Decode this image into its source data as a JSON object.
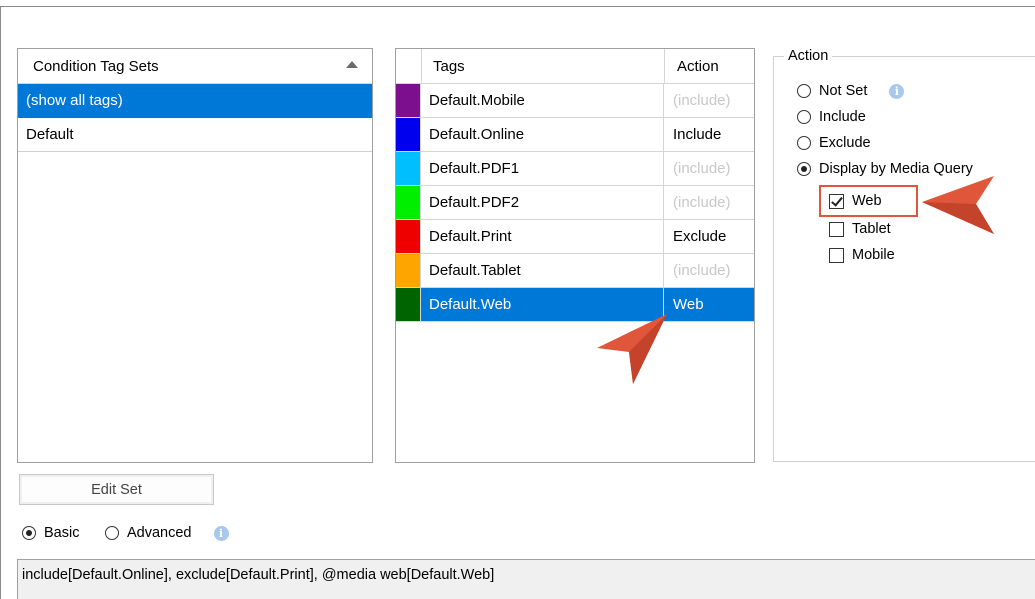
{
  "condition_tag_sets": {
    "header": "Condition Tag Sets",
    "items": [
      {
        "label": "(show all tags)",
        "selected": true
      },
      {
        "label": "Default",
        "selected": false
      }
    ]
  },
  "tags_grid": {
    "headers": {
      "tags": "Tags",
      "action": "Action"
    },
    "rows": [
      {
        "color": "#7b0f8e",
        "name": "Default.Mobile",
        "action": "(include)",
        "muted": true
      },
      {
        "color": "#0000ee",
        "name": "Default.Online",
        "action": "Include",
        "muted": false
      },
      {
        "color": "#00bfff",
        "name": "Default.PDF1",
        "action": "(include)",
        "muted": true
      },
      {
        "color": "#00ee00",
        "name": "Default.PDF2",
        "action": "(include)",
        "muted": true
      },
      {
        "color": "#ee0000",
        "name": "Default.Print",
        "action": "Exclude",
        "muted": false
      },
      {
        "color": "#ffa500",
        "name": "Default.Tablet",
        "action": "(include)",
        "muted": true
      },
      {
        "color": "#006400",
        "name": "Default.Web",
        "action": "Web",
        "muted": false,
        "selected": true
      }
    ]
  },
  "action_panel": {
    "title": "Action",
    "options": {
      "not_set": "Not Set",
      "include": "Include",
      "exclude": "Exclude",
      "display_by_media_query": "Display by Media Query"
    },
    "selected_option": "display_by_media_query",
    "media": {
      "web": "Web",
      "tablet": "Tablet",
      "mobile": "Mobile"
    },
    "checked_media": [
      "web"
    ]
  },
  "bottom": {
    "edit_set": "Edit Set",
    "mode_basic": "Basic",
    "mode_advanced": "Advanced",
    "selected_mode": "basic",
    "expression": "include[Default.Online], exclude[Default.Print], @media web[Default.Web]"
  },
  "colors": {
    "selection": "#0078d7",
    "callout": "#e0563b",
    "info": "#a8c8ec"
  },
  "icons": [
    "info-icon",
    "sort-ascending-icon",
    "callout-arrow-icon"
  ]
}
